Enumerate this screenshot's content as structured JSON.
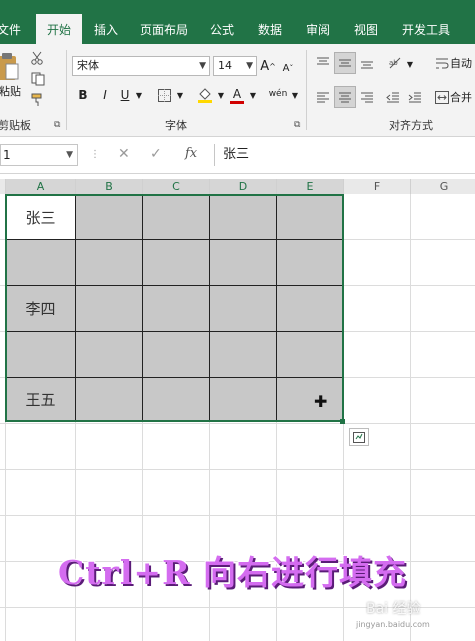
{
  "ribbon_tabs": [
    "文件",
    "开始",
    "插入",
    "页面布局",
    "公式",
    "数据",
    "审阅",
    "视图",
    "开发工具"
  ],
  "clipboard": {
    "paste_label": "粘贴",
    "group_label": "剪贴板"
  },
  "font": {
    "name": "宋体",
    "size": "14",
    "grow": "A",
    "shrink": "A",
    "group_label": "字体",
    "bold": "B",
    "italic": "I",
    "underline": "U",
    "phonetic": "wén",
    "font_color_letter": "A"
  },
  "alignment": {
    "wrap_label": "自动",
    "merge_label": "合并",
    "group_label": "对齐方式"
  },
  "formula_bar": {
    "name_box": "1",
    "cancel": "✕",
    "enter": "✓",
    "fx": "fx",
    "content": "张三"
  },
  "columns": [
    "A",
    "B",
    "C",
    "D",
    "E",
    "F",
    "G"
  ],
  "cells": {
    "a1": "张三",
    "a3": "李四",
    "a5": "王五"
  },
  "caption": "Ctrl+R 向右进行填充",
  "watermark": "Bai 经验",
  "watermark_url": "jingyan.baidu.com",
  "colors": {
    "accent": "#217346",
    "filled_cell": "#c8c8c8",
    "caption": "#d46cf0"
  }
}
